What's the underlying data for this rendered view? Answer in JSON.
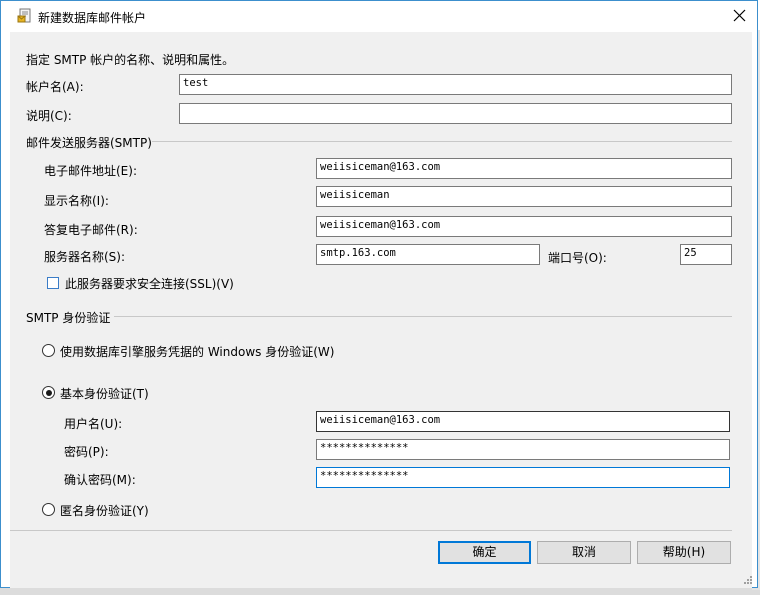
{
  "window": {
    "title": "新建数据库邮件帐户"
  },
  "intro": "指定 SMTP 帐户的名称、说明和属性。",
  "account": {
    "name_label": "帐户名(A):",
    "name_value": "test",
    "desc_label": "说明(C):",
    "desc_value": ""
  },
  "smtp": {
    "group_label": "邮件发送服务器(SMTP)",
    "email_label": "电子邮件地址(E):",
    "email_value": "weiisiceman@163.com",
    "display_label": "显示名称(I):",
    "display_value": "weiisiceman",
    "reply_label": "答复电子邮件(R):",
    "reply_value": "weiisiceman@163.com",
    "server_label": "服务器名称(S):",
    "server_value": "smtp.163.com",
    "port_label": "端口号(O):",
    "port_value": "25",
    "ssl_label": "此服务器要求安全连接(SSL)(V)",
    "ssl_checked": false
  },
  "auth": {
    "group_label": "SMTP 身份验证",
    "windows_label": "使用数据库引擎服务凭据的 Windows 身份验证(W)",
    "basic_label": "基本身份验证(T)",
    "user_label": "用户名(U):",
    "user_value": "weiisiceman@163.com",
    "password_label": "密码(P):",
    "password_value": "**************",
    "confirm_label": "确认密码(M):",
    "confirm_value": "**************",
    "anonymous_label": "匿名身份验证(Y)",
    "selected": "basic"
  },
  "buttons": {
    "ok": "确定",
    "cancel": "取消",
    "help": "帮助(H)"
  }
}
